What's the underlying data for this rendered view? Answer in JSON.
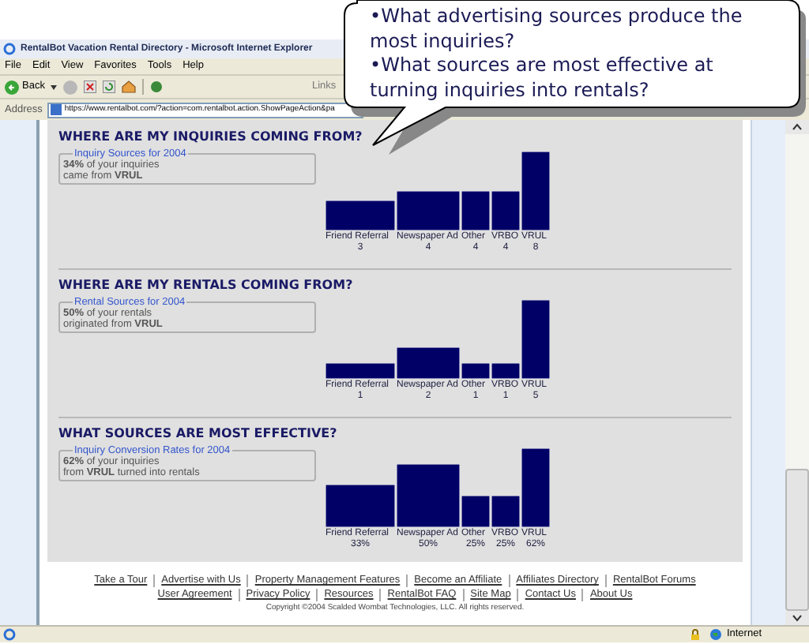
{
  "window": {
    "title": "RentalBot Vacation Rental Directory - Microsoft Internet Explorer"
  },
  "menu": [
    "File",
    "Edit",
    "View",
    "Favorites",
    "Tools",
    "Help"
  ],
  "toolbar": {
    "back": "Back",
    "links": "Links"
  },
  "address": {
    "label": "Address",
    "url": "https://www.rentalbot.com/?action=com.rentalbot.action.ShowPageAction&pa"
  },
  "callout": [
    "•What advertising sources produce the most inquiries?",
    "•What sources are most effective at turning inquiries into rentals?"
  ],
  "sections": [
    {
      "heading": "WHERE ARE MY INQUIRIES COMING FROM?",
      "box_title": "Inquiry Sources for 2004",
      "summary": [
        "**34%** of your inquiries",
        "came from **VRUL**"
      ],
      "chart_data": {
        "type": "bar",
        "categories": [
          "Friend Referral",
          "Newspaper Ad",
          "Other",
          "VRBO",
          "VRUL"
        ],
        "values": [
          3,
          4,
          4,
          4,
          8
        ],
        "value_labels": [
          "3",
          "4",
          "4",
          "4",
          "8"
        ]
      }
    },
    {
      "heading": "WHERE ARE MY RENTALS COMING FROM?",
      "box_title": "Rental Sources for 2004",
      "summary": [
        "**50%** of your rentals",
        "originated from **VRUL**"
      ],
      "chart_data": {
        "type": "bar",
        "categories": [
          "Friend Referral",
          "Newspaper Ad",
          "Other",
          "VRBO",
          "VRUL"
        ],
        "values": [
          1,
          2,
          1,
          1,
          5
        ],
        "value_labels": [
          "1",
          "2",
          "1",
          "1",
          "5"
        ]
      }
    },
    {
      "heading": "WHAT SOURCES ARE MOST EFFECTIVE?",
      "box_title": "Inquiry Conversion Rates for 2004",
      "summary": [
        "**62%** of your inquiries",
        "from **VRUL** turned into rentals"
      ],
      "chart_data": {
        "type": "bar",
        "categories": [
          "Friend Referral",
          "Newspaper Ad",
          "Other",
          "VRBO",
          "VRUL"
        ],
        "values": [
          33,
          50,
          25,
          25,
          62
        ],
        "value_labels": [
          "33%",
          "50%",
          "25%",
          "25%",
          "62%"
        ]
      }
    }
  ],
  "footer": {
    "links": [
      [
        "Take a Tour",
        "Advertise with Us",
        "Property Management Features",
        "Become an Affiliate",
        "Affiliates Directory",
        "RentalBot Forums"
      ],
      [
        "User Agreement",
        "Privacy Policy",
        "Resources",
        "RentalBot FAQ",
        "Site Map",
        "Contact Us",
        "About Us"
      ]
    ],
    "copyright": "Copyright ©2004 Scalded Wombat Technologies, LLC. All rights reserved."
  },
  "status_bar": {
    "zone": "Internet"
  }
}
